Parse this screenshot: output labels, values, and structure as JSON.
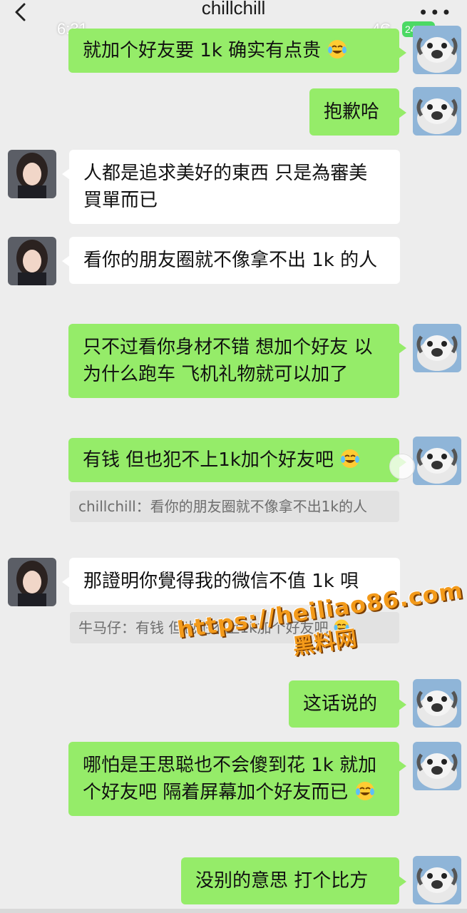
{
  "header": {
    "title": "chillchill",
    "status_time": "6:31",
    "network": "4G",
    "battery": "24"
  },
  "messages": [
    {
      "text": "就加个好友要 1k  确实有点贵"
    },
    {
      "text": "抱歉哈"
    },
    {
      "text": "人都是追求美好的東西 只是為審美買單而已"
    },
    {
      "text": "看你的朋友圈就不像拿不出 1k 的人"
    },
    {
      "text": "只不过看你身材不错 想加个好友 以为什么跑车 飞机礼物就可以加了"
    },
    {
      "text": "有钱 但也犯不上1k加个好友吧",
      "quote": "chillchill：看你的朋友圈就不像拿不出1k的人"
    },
    {
      "text": "那證明你覺得我的微信不值 1k 唄",
      "quote": "牛马仔：有钱 但也犯不上1k加个好友吧"
    },
    {
      "text": "这话说的"
    },
    {
      "text": "哪怕是王思聪也不会傻到花 1k 就加个好友吧 隔着屏幕加个好友而已"
    },
    {
      "text": "没别的意思 打个比方"
    }
  ],
  "watermark": {
    "url": "https://heiliao86.com",
    "name": "黑料网"
  },
  "colors": {
    "background": "#ededed",
    "sent_bubble": "#95ec69",
    "received_bubble": "#ffffff",
    "quote_bg": "#e2e2e2"
  },
  "icons": {
    "back": "chevron-left-icon",
    "more": "more-dots-icon",
    "emoji": "laughing-crying-emoji-icon"
  }
}
